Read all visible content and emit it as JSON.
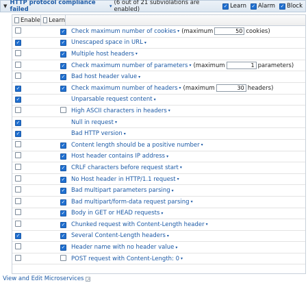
{
  "header": {
    "title": "HTTP protocol compliance failed",
    "subtitle": "(6 out of 21 subviolations are enabled)",
    "options": [
      {
        "label": "Learn",
        "checked": true
      },
      {
        "label": "Alarm",
        "checked": true
      },
      {
        "label": "Block",
        "checked": true
      }
    ]
  },
  "columns": {
    "enable": "Enable",
    "learn": "Learn"
  },
  "rows": [
    {
      "enable": false,
      "learn": true,
      "label": "Check maximum number of cookies",
      "pre": "(maximum",
      "value": "50",
      "post": "cookies)"
    },
    {
      "enable": true,
      "learn": true,
      "label": "Unescaped space in URL"
    },
    {
      "enable": false,
      "learn": true,
      "label": "Multiple host headers"
    },
    {
      "enable": false,
      "learn": true,
      "label": "Check maximum number of parameters",
      "pre": "(maximum",
      "value": "1",
      "post": "parameters)"
    },
    {
      "enable": false,
      "learn": true,
      "label": "Bad host header value"
    },
    {
      "enable": true,
      "learn": true,
      "label": "Check maximum number of headers",
      "pre": "(maximum",
      "value": "30",
      "post": "headers)"
    },
    {
      "enable": true,
      "learn": null,
      "label": "Unparsable request content"
    },
    {
      "enable": false,
      "learn": false,
      "label": "High ASCII characters in headers"
    },
    {
      "enable": true,
      "learn": null,
      "label": "Null in request"
    },
    {
      "enable": true,
      "learn": null,
      "label": "Bad HTTP version"
    },
    {
      "enable": false,
      "learn": true,
      "label": "Content length should be a positive number"
    },
    {
      "enable": false,
      "learn": true,
      "label": "Host header contains IP address"
    },
    {
      "enable": false,
      "learn": true,
      "label": "CRLF characters before request start"
    },
    {
      "enable": false,
      "learn": true,
      "label": "No Host header in HTTP/1.1 request"
    },
    {
      "enable": false,
      "learn": true,
      "label": "Bad multipart parameters parsing"
    },
    {
      "enable": false,
      "learn": true,
      "label": "Bad multipart/form-data request parsing"
    },
    {
      "enable": false,
      "learn": true,
      "label": "Body in GET or HEAD requests"
    },
    {
      "enable": false,
      "learn": true,
      "label": "Chunked request with Content-Length header"
    },
    {
      "enable": true,
      "learn": true,
      "label": "Several Content-Length headers"
    },
    {
      "enable": false,
      "learn": true,
      "label": "Header name with no header value"
    },
    {
      "enable": false,
      "learn": false,
      "label": "POST request with Content-Length: 0"
    }
  ],
  "footer": {
    "link": "View and Edit Microservices"
  }
}
